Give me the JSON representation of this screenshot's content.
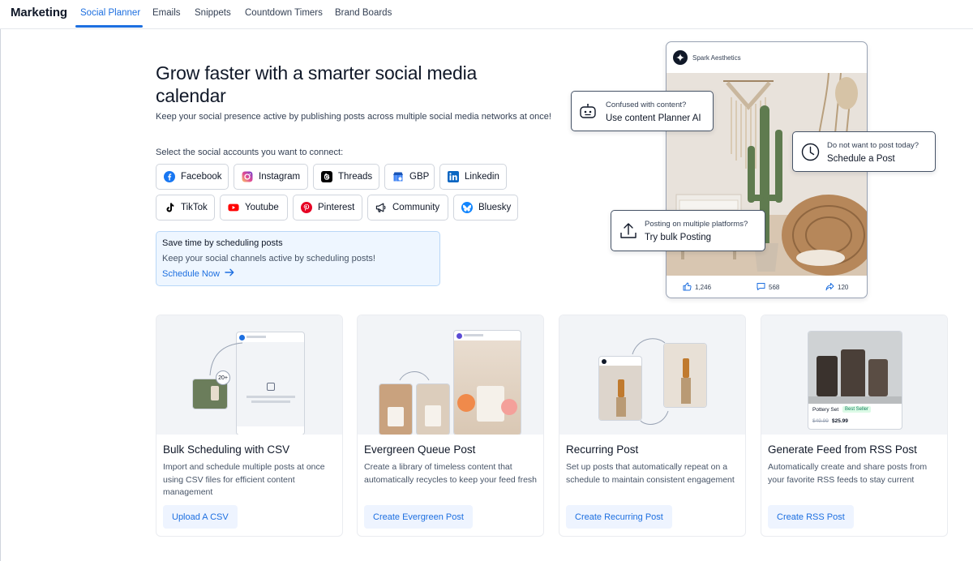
{
  "nav": {
    "brand": "Marketing",
    "tabs": [
      "Social Planner",
      "Emails",
      "Snippets",
      "Countdown Timers",
      "Brand Boards"
    ]
  },
  "hero": {
    "title": "Grow faster with a smarter social media calendar",
    "subtitle": "Keep your social presence active by publishing posts across multiple social media networks at once!",
    "select_label": "Select the social accounts you want to connect:",
    "accounts": [
      "Facebook",
      "Instagram",
      "Threads",
      "GBP",
      "Linkedin",
      "TikTok",
      "Youtube",
      "Pinterest",
      "Community",
      "Bluesky"
    ]
  },
  "promo": {
    "title": "Save time by scheduling posts",
    "subtitle": "Keep your social channels active by scheduling posts!",
    "link": "Schedule Now"
  },
  "preview": {
    "account": "Spark Aesthetics",
    "likes": "1,246",
    "comments": "568",
    "shares": "120",
    "callouts": [
      {
        "top": "Confused with content?",
        "bottom": "Use content Planner AI"
      },
      {
        "top": "Do not want to post today?",
        "bottom": "Schedule a Post"
      },
      {
        "top": "Posting on multiple platforms?",
        "bottom": "Try bulk Posting"
      }
    ]
  },
  "cards": [
    {
      "title": "Bulk Scheduling with CSV",
      "desc": "Import and schedule multiple posts at once using CSV files for efficient content management",
      "button": "Upload A CSV",
      "badge": "20+"
    },
    {
      "title": "Evergreen Queue Post",
      "desc": "Create a library of timeless content that automatically recycles to keep your feed fresh",
      "button": "Create Evergreen Post"
    },
    {
      "title": "Recurring Post",
      "desc": "Set up posts that automatically repeat on a schedule to maintain consistent engagement",
      "button": "Create Recurring Post"
    },
    {
      "title": "Generate Feed from RSS Post",
      "desc": "Automatically create and share posts from your favorite RSS feeds to stay current",
      "button": "Create RSS Post",
      "product": "Pottery Set",
      "product_badge": "Best Seller",
      "old_price": "$49.99",
      "price": "$25.99"
    }
  ],
  "colors": {
    "accent": "#1d6fe0",
    "promo_bg": "#eef6ff"
  }
}
